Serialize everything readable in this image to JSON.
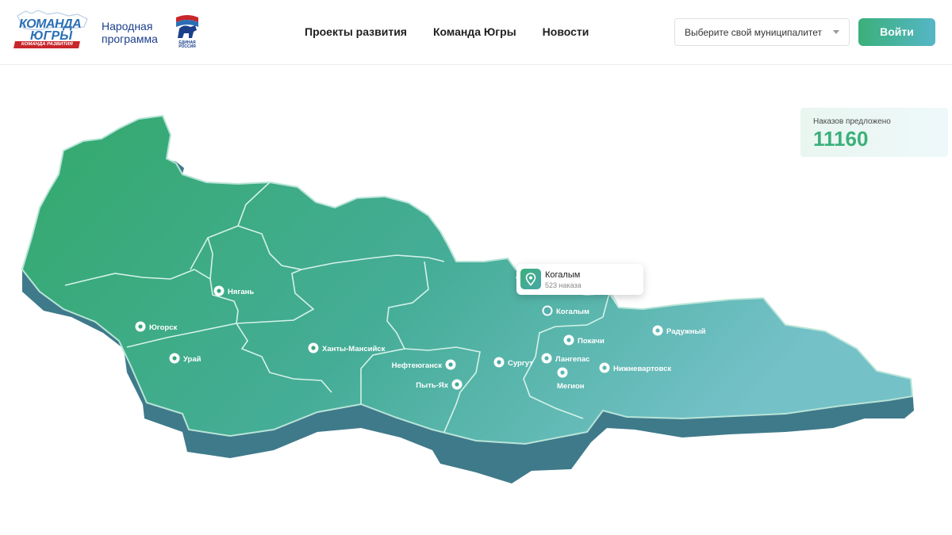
{
  "header": {
    "logo_komanda": {
      "line1": "КОМАНДА",
      "line2": "ЮГРЫ",
      "ribbon": "КОМАНДА РАЗВИТИЯ"
    },
    "people_program": {
      "line1": "Народная",
      "line2": "программа"
    },
    "er_logo": {
      "line1": "ЕДИНАЯ",
      "line2": "РОССИЯ"
    },
    "nav": [
      {
        "label": "Проекты развития"
      },
      {
        "label": "Команда Югры"
      },
      {
        "label": "Новости"
      }
    ],
    "municipality_select": {
      "value": "Выберите свой муниципалитет"
    },
    "login_label": "Войти"
  },
  "counter": {
    "label": "Наказов предложено",
    "value": "11160"
  },
  "tooltip": {
    "city": "Когалым",
    "count": "523 наказа"
  },
  "cities": [
    {
      "id": "nyagan",
      "label": "Нягань"
    },
    {
      "id": "yugorsk",
      "label": "Югорск"
    },
    {
      "id": "uray",
      "label": "Урай"
    },
    {
      "id": "khanty",
      "label": "Ханты-Мансийск"
    },
    {
      "id": "nefteyugansk",
      "label": "Нефтеюганск"
    },
    {
      "id": "pytyakh",
      "label": "Пыть-Ях"
    },
    {
      "id": "surgut",
      "label": "Сургут"
    },
    {
      "id": "kogalym",
      "label": "Когалым"
    },
    {
      "id": "pokachi",
      "label": "Покачи"
    },
    {
      "id": "langepas",
      "label": "Лангепас"
    },
    {
      "id": "megion",
      "label": "Мегион"
    },
    {
      "id": "nizhnevartovsk",
      "label": "Нижневартовск"
    },
    {
      "id": "raduzhny",
      "label": "Радужный"
    }
  ],
  "colors": {
    "accent_green": "#3bb07a",
    "map_dark_side": "#3f7a8a",
    "map_light": "#6bbfc4"
  }
}
